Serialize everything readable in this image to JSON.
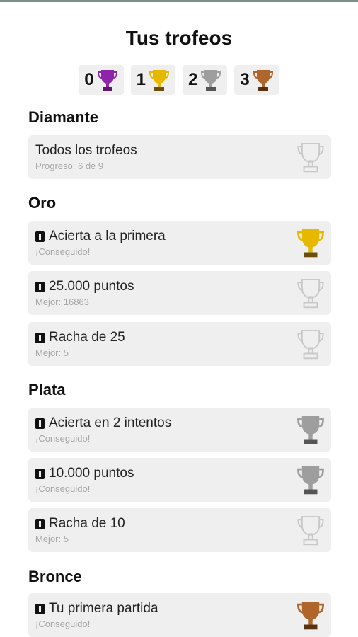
{
  "header": {
    "title": "Tus trofeos"
  },
  "counters": [
    {
      "count": "0",
      "icon": "diamond-trophy-icon",
      "color": "#8e24aa"
    },
    {
      "count": "1",
      "icon": "gold-trophy-icon",
      "color": "#e6b800"
    },
    {
      "count": "2",
      "icon": "silver-trophy-icon",
      "color": "#9e9e9e"
    },
    {
      "count": "3",
      "icon": "bronze-trophy-icon",
      "color": "#b0652a"
    }
  ],
  "sections": {
    "diamond": {
      "title": "Diamante"
    },
    "gold": {
      "title": "Oro"
    },
    "silver": {
      "title": "Plata"
    },
    "bronze": {
      "title": "Bronce"
    }
  },
  "items": {
    "all": {
      "name": "Todos los trofeos",
      "sub": "Progreso: 6 de 9"
    },
    "first_try": {
      "name": "Acierta a la primera",
      "sub": "¡Conseguido!"
    },
    "points_25k": {
      "name": "25.000 puntos",
      "sub": "Mejor: 16863"
    },
    "streak_25": {
      "name": "Racha de 25",
      "sub": "Mejor: 5"
    },
    "two_tries": {
      "name": "Acierta en 2 intentos",
      "sub": "¡Conseguido!"
    },
    "points_10k": {
      "name": "10.000 puntos",
      "sub": "¡Conseguido!"
    },
    "streak_10": {
      "name": "Racha de 10",
      "sub": "Mejor: 5"
    },
    "first_game": {
      "name": "Tu primera partida",
      "sub": "¡Conseguido!"
    }
  },
  "colors": {
    "gold": "#e6b800",
    "silver": "#9e9e9e",
    "bronze": "#b0652a",
    "diamond": "#8e24aa",
    "locked_outline": "#c8c8c8"
  }
}
